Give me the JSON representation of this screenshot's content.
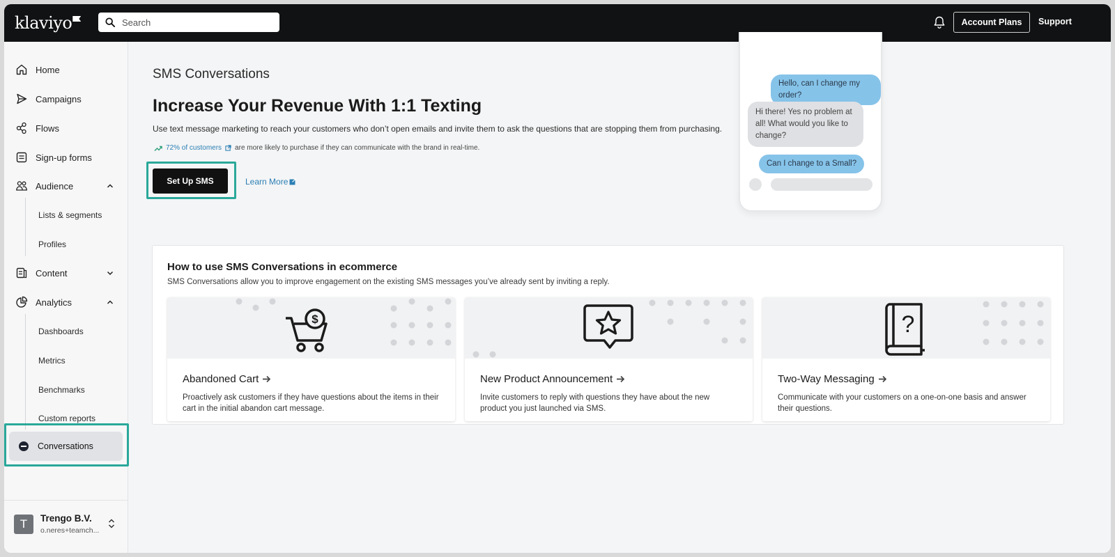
{
  "topbar": {
    "logo": "klaviyo",
    "search_placeholder": "Search",
    "account_plans": "Account Plans",
    "support": "Support"
  },
  "sidebar": {
    "items": [
      {
        "label": "Home",
        "icon": "home-icon"
      },
      {
        "label": "Campaigns",
        "icon": "send-icon"
      },
      {
        "label": "Flows",
        "icon": "flows-icon"
      },
      {
        "label": "Sign-up forms",
        "icon": "form-icon"
      },
      {
        "label": "Audience",
        "icon": "people-icon"
      },
      {
        "label": "Content",
        "icon": "content-icon"
      },
      {
        "label": "Analytics",
        "icon": "pie-chart-icon"
      }
    ],
    "audience_sub": [
      "Lists & segments",
      "Profiles"
    ],
    "analytics_sub": [
      "Dashboards",
      "Metrics",
      "Benchmarks",
      "Custom reports"
    ],
    "active": "Conversations",
    "org": {
      "initial": "T",
      "name": "Trengo B.V.",
      "email": "o.neres+teamch..."
    }
  },
  "main": {
    "page_title": "SMS Conversations",
    "headline": "Increase Your Revenue With 1:1 Texting",
    "description": "Use text message marketing to reach your customers who don’t open emails and invite them to ask the questions that are stopping them from purchasing.",
    "stat_link": "72% of customers",
    "stat_text": "are more likely to purchase if they can communicate with the brand in real-time.",
    "setup_button": "Set Up SMS",
    "learn_more": "Learn More"
  },
  "phone": {
    "messages": [
      {
        "from": "customer",
        "text": "Hello, can I change my order?"
      },
      {
        "from": "brand",
        "text": "Hi there! Yes no problem at all! What would you like to change?"
      },
      {
        "from": "customer",
        "text": "Can I change to a Small?"
      }
    ]
  },
  "howto": {
    "title": "How to use SMS Conversations in ecommerce",
    "subtitle": "SMS Conversations allow you to improve engagement on the existing SMS messages you’ve already sent by inviting a reply.",
    "cards": [
      {
        "title": "Abandoned Cart",
        "icon": "cart-dollar-icon",
        "desc": "Proactively ask customers if they have questions about the items in their cart in the initial abandon cart message."
      },
      {
        "title": "New Product Announcement",
        "icon": "star-chat-icon",
        "desc": "Invite customers to reply with questions they have about the new product you just launched via SMS."
      },
      {
        "title": "Two-Way Messaging",
        "icon": "question-book-icon",
        "desc": "Communicate with your customers on a one-on-one basis and answer their questions."
      }
    ]
  },
  "colors": {
    "accent_highlight": "#2aa89a",
    "link": "#2b7fb5",
    "bubble_out": "#86c3e9",
    "bubble_in": "#dfe0e3"
  }
}
